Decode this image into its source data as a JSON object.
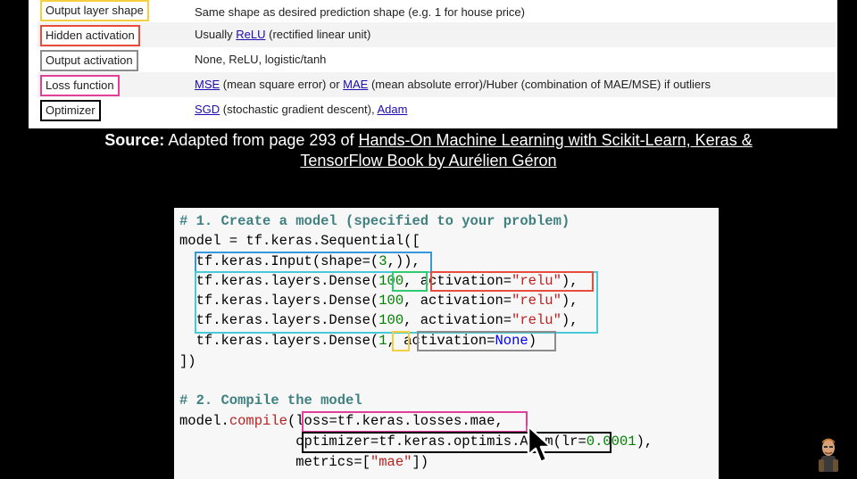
{
  "table": {
    "rows": [
      {
        "param": "Output layer shape",
        "color": "#f4d03f",
        "value": "Same shape as desired prediction shape (e.g. 1 for house price)"
      },
      {
        "param": "Hidden activation",
        "color": "#e74c3c",
        "value_link": "ReLU",
        "value_pre": "Usually ",
        "value_post": " (rectified linear unit)"
      },
      {
        "param": "Output activation",
        "color": "#8c8c8c",
        "value": "None, ReLU, logistic/tanh"
      },
      {
        "param": "Loss function",
        "color": "#e0409a",
        "value_link": "MSE",
        "value_link2": "MAE",
        "value_mid": " (mean square error) or ",
        "value_post": " (mean absolute error)/Huber (combination of MAE/MSE) if outliers"
      },
      {
        "param": "Optimizer",
        "color": "#000000",
        "value_link": "SGD",
        "value_link2": "Adam",
        "value_mid": " (stochastic gradient descent), ",
        "value_post": ""
      }
    ]
  },
  "source": {
    "label": "Source:",
    "text": " Adapted from page 293 of ",
    "link1": "Hands-On Machine Learning with Scikit-Learn, Keras &",
    "link2": "TensorFlow Book by Aurélien Géron"
  },
  "code": {
    "l1": "# 1. Create a model (specified to your problem)",
    "l2": "model = tf.keras.Sequential([",
    "l3a": "  tf.keras.Input(shape=(",
    "l3n": "3",
    "l3b": ",)),",
    "l4a": "  tf.keras.layers.Dense(",
    "l4n": "100",
    "l4b": ", activation=",
    "l4s": "\"relu\"",
    "l4c": "),",
    "l5a": "  tf.keras.layers.Dense(",
    "l5n": "100",
    "l5b": ", activation=",
    "l5s": "\"relu\"",
    "l5c": "),",
    "l6a": "  tf.keras.layers.Dense(",
    "l6n": "100",
    "l6b": ", activation=",
    "l6s": "\"relu\"",
    "l6c": "),",
    "l7a": "  tf.keras.layers.Dense(",
    "l7n": "1",
    "l7b": ", activation=",
    "l7k": "None",
    "l7c": ")",
    "l8": "])",
    "l9": "# 2. Compile the model",
    "l10a": "model.",
    "l10f": "compile",
    "l10b": "(loss=tf.keras.losses.mae,",
    "l11a": "              optimizer=tf.keras.optimi",
    "l11b": "s.Adam(lr=",
    "l11n": "0.0001",
    "l11c": "),",
    "l12a": "              metrics=[",
    "l12s": "\"mae\"",
    "l12b": "])"
  }
}
